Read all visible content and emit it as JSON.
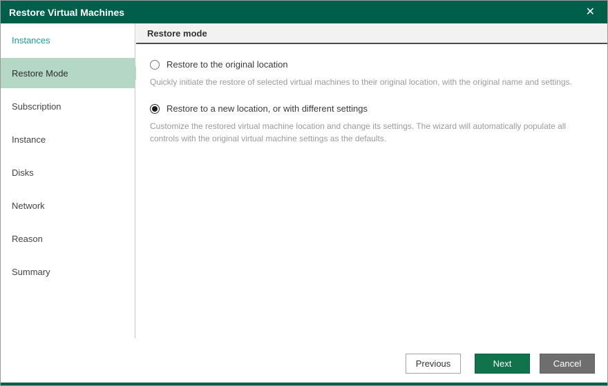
{
  "window": {
    "title": "Restore Virtual Machines",
    "close_icon": "✕"
  },
  "sidebar": {
    "items": [
      {
        "label": "Instances",
        "state": "done"
      },
      {
        "label": "Restore Mode",
        "state": "active"
      },
      {
        "label": "Subscription",
        "state": "upcoming"
      },
      {
        "label": "Instance",
        "state": "upcoming"
      },
      {
        "label": "Disks",
        "state": "upcoming"
      },
      {
        "label": "Network",
        "state": "upcoming"
      },
      {
        "label": "Reason",
        "state": "upcoming"
      },
      {
        "label": "Summary",
        "state": "upcoming"
      }
    ]
  },
  "content": {
    "header": "Restore mode",
    "options": [
      {
        "label": "Restore to the original location",
        "selected": false,
        "description": "Quickly initiate the restore of selected virtual machines to their original location, with the original name and settings."
      },
      {
        "label": "Restore to a new location, or with different settings",
        "selected": true,
        "description": "Customize the restored virtual machine location and change its settings. The wizard will automatically populate all controls with the original virtual machine settings as the defaults."
      }
    ]
  },
  "footer": {
    "previous_label": "Previous",
    "next_label": "Next",
    "cancel_label": "Cancel"
  },
  "colors": {
    "titlebar": "#005f4b",
    "active_step_bg": "#b5d7c6",
    "done_step_text": "#1c9aa5",
    "next_button": "#11734c",
    "cancel_button": "#6e6e6e"
  }
}
